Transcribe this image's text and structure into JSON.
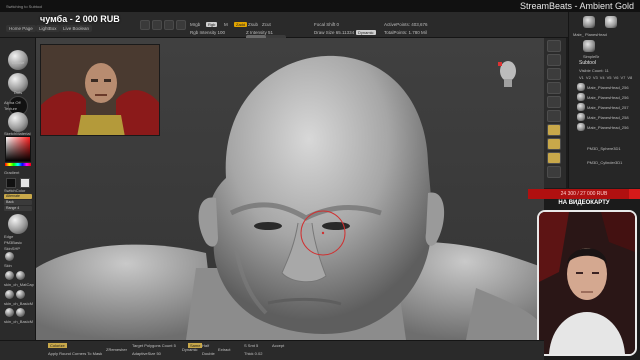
{
  "window": {
    "title_left": "Switching to Subtool",
    "stream_title": "StreamBeats - Ambient Gold"
  },
  "toolbar": {
    "tabs": [
      "Home Page",
      "LightBox",
      "Live Boolean"
    ],
    "mrgb": "Mrgb",
    "rgb": "Rgb",
    "m": "M",
    "zadd": "Zadd",
    "zsub": "Zsub",
    "zcut": "Zcut",
    "rgb_intensity": "Rgb Intensity 100",
    "z_intensity": "Z Intensity 51",
    "z_intensity_value": 51,
    "focal_shift": "Focal Shift 0",
    "draw_size": "Draw Size 65.11334",
    "dynamic": "Dynamic",
    "active_points": "ActivePoints: 403,676",
    "total_points": "TotalPoints: 1.780 Mil"
  },
  "overlay": {
    "donation": "чумба - 2 000 RUB"
  },
  "left_tray": {
    "labels": [
      "Diffuse",
      "Dots",
      "Alpha Off",
      "Texture",
      "SketchMaterial",
      "Gradient",
      "SwitchColor",
      "Alternate",
      "Back",
      "Range 4",
      "Edge",
      "PM3Basic",
      "SkinSHP",
      "Skin",
      "skin_ch_MatCap",
      "skin_ch_BasicM",
      "skin_ch_BasicM"
    ]
  },
  "right_icons": {
    "labels": [
      "BPR",
      "SPix 3",
      "Scroll",
      "Zoom",
      "Actual",
      "AAHalf",
      "Persp",
      "Floor",
      "Local",
      "Frame",
      "Move",
      "Scale",
      "Rotate",
      "Transp",
      "Ghost",
      "Solo"
    ]
  },
  "subtool": {
    "thumb_label": "Male_ PlanesHead",
    "simplebrush": "SimpleBr",
    "title": "Subtool",
    "visible_count": "Visible Count: 11",
    "columns": [
      "V1",
      "V2",
      "V3",
      "V4",
      "V5",
      "V6",
      "V7",
      "V8"
    ],
    "items": [
      "Male_PlanesHead_256",
      "Male_PlanesHead_256",
      "Male_PlanesHead_257",
      "Male_PlanesHead_258",
      "Male_PlanesHead_256",
      "PM3D_Sphere3D1",
      "PM3D_Cylinder3D1"
    ]
  },
  "donate": {
    "bar": "24 300 / 27 000 RUB",
    "text": "НА ВИДЕОКАРТУ",
    "progress_fraction": 0.9
  },
  "bottombar": {
    "colorize": "Colorize",
    "apply_round": "Apply Round Corners To Mask",
    "zremesher": "ZRemesher",
    "target_polygons": "Target Polygons Count 5",
    "adaptive_size": "AdaptiveSize 50",
    "dynamic": "Dynamic",
    "half": "Half",
    "double": "Double",
    "same": "Same",
    "extract": "Extract",
    "s_smt": "S Smt 5",
    "thick": "Thick 0.02",
    "accept": "Accept"
  },
  "colors": {
    "accent_gold": "#c8a84a",
    "donate_red": "#d61a1a",
    "brush_circle": "#d03030"
  }
}
